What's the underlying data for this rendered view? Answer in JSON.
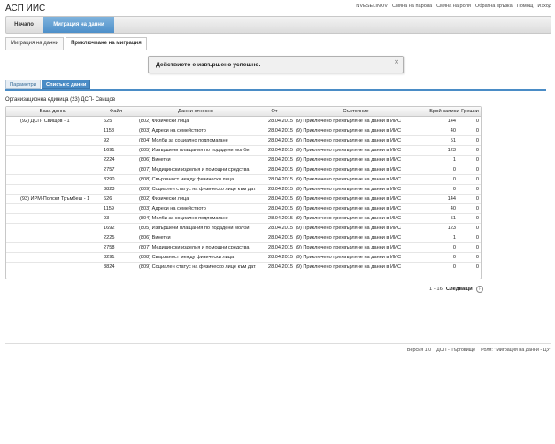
{
  "app": {
    "title": "АСП ИИС"
  },
  "top_links": [
    "NVESELINOV",
    "Смяна на парола",
    "Смяна на роля",
    "Обратна връзка",
    "Помощ",
    "Изход"
  ],
  "nav": {
    "home": "Начало",
    "migration": "Миграция на данни"
  },
  "breadcrumb": [
    "Миграция на данни",
    "Приключване на миграция"
  ],
  "alert": {
    "message": "Действието е извършено успешно.",
    "close": "×"
  },
  "tabs": [
    "Параметри",
    "Списък с данни"
  ],
  "org_unit": "Организационна единица (23) ДСП- Свищов",
  "table": {
    "headers": [
      "База данни",
      "Файл",
      "Данни относно",
      "От",
      "Състояние",
      "Брой записи",
      "Грешки"
    ],
    "rows": [
      [
        "(92) ДСП- Свищов - 1",
        "625",
        "(802) Физически лица",
        "28.04.2015",
        "(9) Приключено прехвърляне на данни в ИИС",
        "144",
        "0"
      ],
      [
        "",
        "1158",
        "(803) Адреси на семейството",
        "28.04.2015",
        "(9) Приключено прехвърляне на данни в ИИС",
        "40",
        "0"
      ],
      [
        "",
        "92",
        "(804) Молби за социално подпомагане",
        "28.04.2015",
        "(9) Приключено прехвърляне на данни в ИИС",
        "51",
        "0"
      ],
      [
        "",
        "1691",
        "(805) Извършени плащания по подадени молби",
        "28.04.2015",
        "(9) Приключено прехвърляне на данни в ИИС",
        "123",
        "0"
      ],
      [
        "",
        "2224",
        "(806) Винетки",
        "28.04.2015",
        "(9) Приключено прехвърляне на данни в ИИС",
        "1",
        "0"
      ],
      [
        "",
        "2757",
        "(807) Медицински изделия и помощни средства",
        "28.04.2015",
        "(9) Приключено прехвърляне на данни в ИИС",
        "0",
        "0"
      ],
      [
        "",
        "3290",
        "(808) Свързаност между физически лица",
        "28.04.2015",
        "(9) Приключено прехвърляне на данни в ИИС",
        "0",
        "0"
      ],
      [
        "",
        "3823",
        "(809) Социален статус на физическо лице към дата",
        "28.04.2015",
        "(9) Приключено прехвърляне на данни в ИИС",
        "0",
        "0"
      ],
      [
        "(93) ИРМ-Полски Тръмбеш - 1",
        "626",
        "(802) Физически лица",
        "28.04.2015",
        "(9) Приключено прехвърляне на данни в ИИС",
        "144",
        "0"
      ],
      [
        "",
        "1159",
        "(803) Адреси на семейството",
        "28.04.2015",
        "(9) Приключено прехвърляне на данни в ИИС",
        "40",
        "0"
      ],
      [
        "",
        "93",
        "(804) Молби за социално подпомагане",
        "28.04.2015",
        "(9) Приключено прехвърляне на данни в ИИС",
        "51",
        "0"
      ],
      [
        "",
        "1692",
        "(805) Извършени плащания по подадени молби",
        "28.04.2015",
        "(9) Приключено прехвърляне на данни в ИИС",
        "123",
        "0"
      ],
      [
        "",
        "2225",
        "(806) Винетки",
        "28.04.2015",
        "(9) Приключено прехвърляне на данни в ИИС",
        "1",
        "0"
      ],
      [
        "",
        "2758",
        "(807) Медицински изделия и помощни средства",
        "28.04.2015",
        "(9) Приключено прехвърляне на данни в ИИС",
        "0",
        "0"
      ],
      [
        "",
        "3291",
        "(808) Свързаност между физически лица",
        "28.04.2015",
        "(9) Приключено прехвърляне на данни в ИИС",
        "0",
        "0"
      ],
      [
        "",
        "3824",
        "(809) Социален статус на физическо лице към дата",
        "28.04.2015",
        "(9) Приключено прехвърляне на данни в ИИС",
        "0",
        "0"
      ]
    ]
  },
  "pager": {
    "range": "1 - 16",
    "next": "Следващи",
    "next_icon": "chevron-right-icon"
  },
  "footer": [
    "Версия 1.0",
    "ДСП - Търговище",
    "Роля: \"Миграция на данни - ЦУ\""
  ]
}
